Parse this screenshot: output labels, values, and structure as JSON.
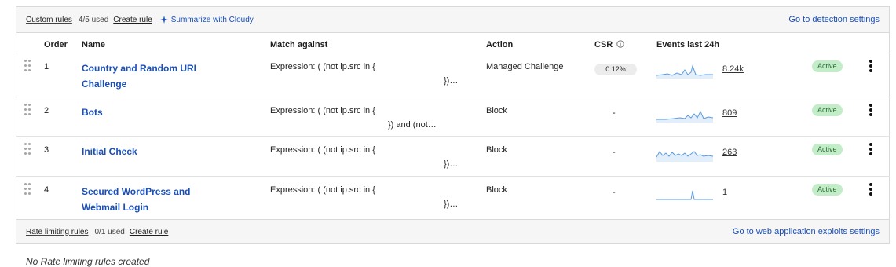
{
  "custom_rules": {
    "title": "Custom rules",
    "used": "4/5 used",
    "create_label": "Create rule",
    "summarize_label": "Summarize with Cloudy",
    "settings_link": "Go to detection settings",
    "columns": {
      "order": "Order",
      "name": "Name",
      "match": "Match against",
      "action": "Action",
      "csr": "CSR",
      "events": "Events last 24h"
    },
    "rows": [
      {
        "order": "1",
        "name": "Country and Random URI Challenge",
        "expr_line1": "Expression: ( (not ip.src in {",
        "expr_line2": "})…",
        "action": "Managed Challenge",
        "csr": "0.12%",
        "events": "8.24k",
        "status": "Active"
      },
      {
        "order": "2",
        "name": "Bots",
        "expr_line1": "Expression: ( (not ip.src in {",
        "expr_line2": "}) and (not…",
        "action": "Block",
        "csr": "-",
        "events": "809",
        "status": "Active"
      },
      {
        "order": "3",
        "name": "Initial Check",
        "expr_line1": "Expression: ( (not ip.src in {",
        "expr_line2": "})…",
        "action": "Block",
        "csr": "-",
        "events": "263",
        "status": "Active"
      },
      {
        "order": "4",
        "name": "Secured WordPress and Webmail Login",
        "expr_line1": "Expression: ( (not ip.src in {",
        "expr_line2": "})…",
        "action": "Block",
        "csr": "-",
        "events": "1",
        "status": "Active"
      }
    ]
  },
  "rate_limiting": {
    "title": "Rate limiting rules",
    "used": "0/1 used",
    "create_label": "Create rule",
    "settings_link": "Go to web application exploits settings",
    "empty_text": "No Rate limiting rules created"
  },
  "icons": {
    "summarize": "sparkle-icon",
    "csr_info": "info-icon",
    "drag": "drag-handle-icon",
    "menu": "kebab-menu-icon"
  },
  "colors": {
    "link": "#1a4fb7",
    "active_badge_bg": "#c3ecc8",
    "active_badge_text": "#2a6b33",
    "sparkline": "#5a9ae0"
  }
}
